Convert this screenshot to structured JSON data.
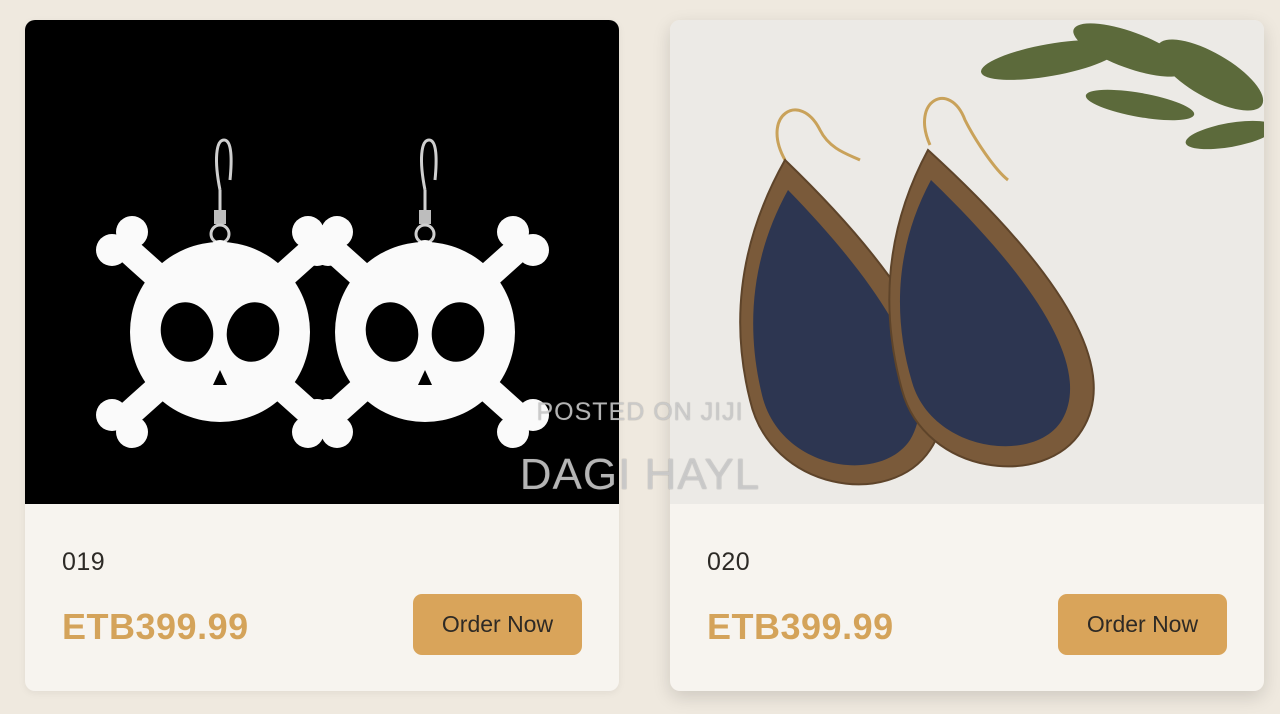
{
  "products": [
    {
      "code": "019",
      "price": "ETB399.99",
      "button_label": "Order Now",
      "image_icon": "skull-earrings-icon"
    },
    {
      "code": "020",
      "price": "ETB399.99",
      "button_label": "Order Now",
      "image_icon": "teardrop-earrings-icon"
    }
  ],
  "watermark": {
    "line1": "POSTED ON JIJI",
    "line2": "DAGI HAYL"
  },
  "colors": {
    "page_background": "#efe9df",
    "card_background": "#f7f4ef",
    "price": "#d4a35a",
    "button": "#d9a45a",
    "button_text": "#2e2a25"
  }
}
